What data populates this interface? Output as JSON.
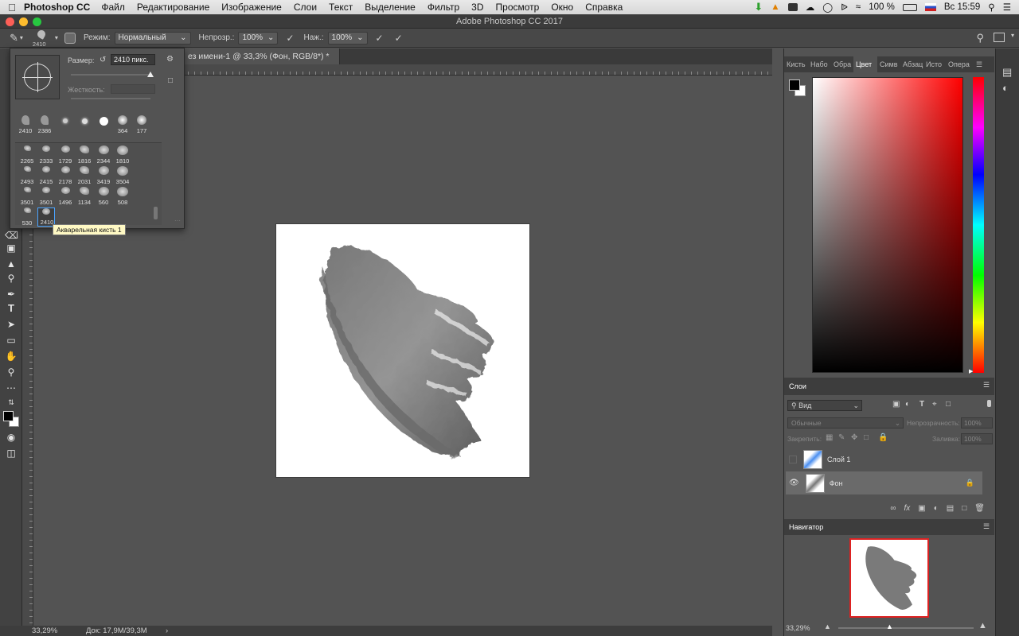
{
  "menubar": {
    "app_name": "Photoshop CC",
    "items": [
      "Файл",
      "Редактирование",
      "Изображение",
      "Слои",
      "Текст",
      "Выделение",
      "Фильтр",
      "3D",
      "Просмотр",
      "Окно",
      "Справка"
    ],
    "battery": "100 %",
    "clock": "Вс 15:59"
  },
  "window": {
    "title": "Adobe Photoshop CC 2017"
  },
  "options_bar": {
    "brush_size": "2410",
    "mode_label": "Режим:",
    "mode_value": "Нормальный",
    "opacity_label": "Непрозр.:",
    "opacity_value": "100%",
    "pressure_label": "Наж.:",
    "pressure_value": "100%"
  },
  "document": {
    "tab_label": "ез имени-1 @ 33,3% (Фон, RGB/8*) *",
    "zoom": "33,29%",
    "doc_info": "Док: 17,9M/39,3M"
  },
  "brush_popup": {
    "size_label": "Размер:",
    "size_value": "2410 пикс.",
    "hardness_label": "Жесткость:",
    "size_slider": 1.0,
    "top_presets": [
      "2410",
      "2386",
      "",
      "",
      "",
      "364",
      "177"
    ],
    "presets": [
      "2265",
      "2333",
      "1729",
      "1816",
      "2344",
      "1810",
      "2493",
      "2415",
      "2178",
      "2031",
      "3419",
      "3504",
      "3501",
      "3501",
      "1496",
      "1134",
      "560",
      "508",
      "530",
      "2410"
    ],
    "tooltip": "Акварельная кисть 1"
  },
  "color_panel": {
    "tabs": [
      "Кисть",
      "Набо",
      "Обра",
      "Цвет",
      "Симв",
      "Абзац",
      "Исто",
      "Опера"
    ],
    "active_tab": "Цвет",
    "hue_color": "#ff0000"
  },
  "layers_panel": {
    "title": "Слои",
    "filter_value": "Вид",
    "blend_mode": "Обычные",
    "opacity_label": "Непрозрачность:",
    "opacity_value": "100%",
    "lock_label": "Закрепить:",
    "fill_label": "Заливка:",
    "fill_value": "100%",
    "layers": [
      {
        "name": "Слой 1"
      },
      {
        "name": "Фон"
      }
    ]
  },
  "navigator_panel": {
    "title": "Навигатор",
    "zoom": "33,29%"
  }
}
